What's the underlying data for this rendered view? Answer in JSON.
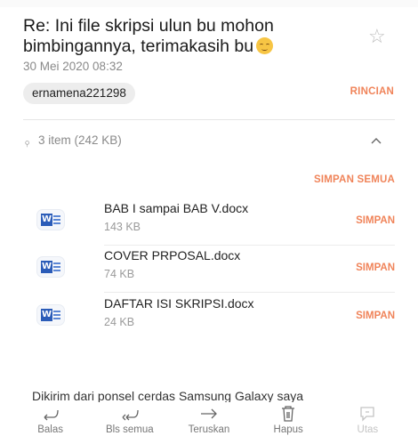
{
  "email": {
    "subject": "Re: Ini file skripsi ulun bu mohon bimbingannya, terimakasih bu",
    "date": "30 Mei 2020  08:32",
    "sender": "ernamena221298",
    "details_label": "RINCIAN"
  },
  "attachments": {
    "summary": "3 item (242 KB)",
    "save_all_label": "SIMPAN SEMUA",
    "items": [
      {
        "name": "BAB I sampai BAB V.docx",
        "size": "143 KB",
        "save_label": "SIMPAN",
        "icon": "word-doc-icon"
      },
      {
        "name": "COVER PRPOSAL.docx",
        "size": "74 KB",
        "save_label": "SIMPAN",
        "icon": "word-doc-icon"
      },
      {
        "name": "DAFTAR ISI SKRIPSI.docx",
        "size": "24 KB",
        "save_label": "SIMPAN",
        "icon": "word-doc-icon"
      }
    ]
  },
  "body": {
    "text": "Dikirim dari ponsel cerdas Samsung Galaxy saya"
  },
  "toolbar": {
    "actions": [
      {
        "label": "Balas",
        "icon": "reply-icon",
        "enabled": true
      },
      {
        "label": "Bls semua",
        "icon": "reply-all-icon",
        "enabled": true
      },
      {
        "label": "Teruskan",
        "icon": "forward-icon",
        "enabled": true
      },
      {
        "label": "Hapus",
        "icon": "trash-icon",
        "enabled": true
      },
      {
        "label": "Utas",
        "icon": "thread-icon",
        "enabled": false
      }
    ]
  },
  "colors": {
    "accent": "#f0845a",
    "word_blue": "#2b5cb8",
    "muted_text": "#8a8a8a"
  }
}
